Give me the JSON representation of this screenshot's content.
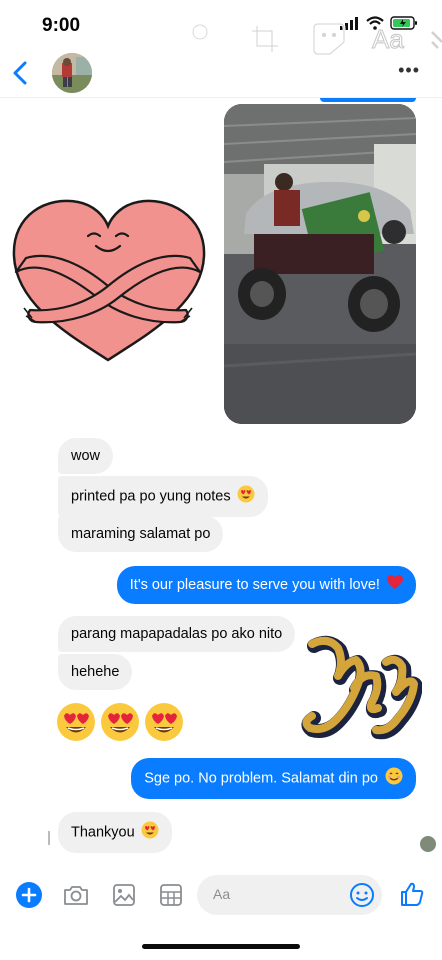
{
  "status": {
    "time": "9:00"
  },
  "overlay": {
    "text_tool": "Aa"
  },
  "header": {
    "more": "•••"
  },
  "messages": [
    {
      "side": "received",
      "text": "wow"
    },
    {
      "side": "received",
      "text": "printed pa po yung notes"
    },
    {
      "side": "received",
      "text": "maraming salamat po"
    },
    {
      "side": "sent",
      "text": "It's our pleasure to serve you with love!"
    },
    {
      "side": "received",
      "text": "parang mapapadalas po ako nito"
    },
    {
      "side": "received",
      "text": "hehehe"
    },
    {
      "side": "sent",
      "text": "Sge po. No problem. Salamat din po"
    },
    {
      "side": "received",
      "text": "Thankyou"
    }
  ],
  "composer": {
    "placeholder": "Aa"
  },
  "colors": {
    "messenger_blue": "#0a7cff",
    "received_bubble": "#f0f0f0",
    "heart_pink": "#f1928f"
  },
  "icons": [
    "back-icon",
    "more-icon",
    "plus-icon",
    "camera-icon",
    "photo-icon",
    "sticker-grid-icon",
    "smiley-icon",
    "like-icon"
  ]
}
